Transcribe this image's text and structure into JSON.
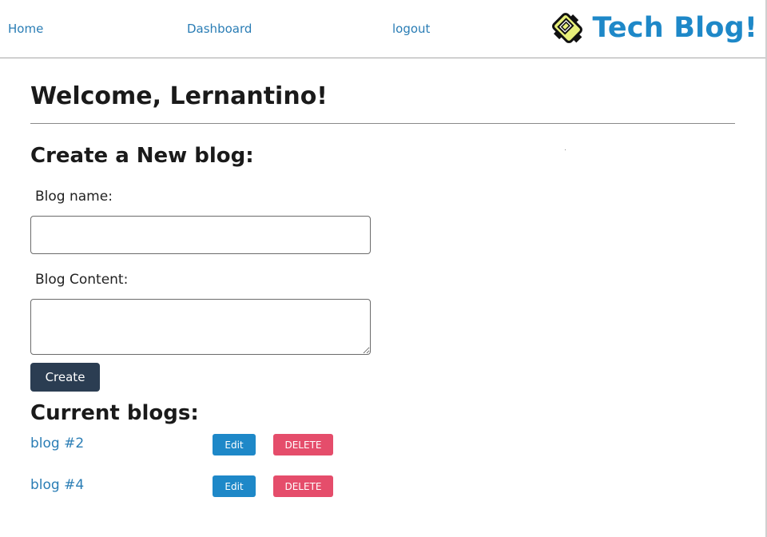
{
  "nav": {
    "home": "Home",
    "dashboard": "Dashboard",
    "logout": "logout",
    "brand_title": "Tech Blog!",
    "brand_icon": "tech-blog-logo-icon"
  },
  "welcome": "Welcome, Lernantino!",
  "create": {
    "heading": "Create a New blog:",
    "name_label": "Blog name:",
    "name_value": "",
    "content_label": "Blog Content:",
    "content_value": "",
    "button_label": "Create"
  },
  "current": {
    "heading": "Current blogs:",
    "blogs": [
      {
        "title": "blog #2",
        "edit_label": "Edit",
        "delete_label": "DELETE"
      },
      {
        "title": "blog #4",
        "edit_label": "Edit",
        "delete_label": "DELETE"
      }
    ]
  },
  "colors": {
    "link": "#2a7db5",
    "brand": "#1e88c8",
    "create_button": "#2b3d52",
    "edit_button": "#1e88c8",
    "delete_button": "#e54d6b"
  }
}
